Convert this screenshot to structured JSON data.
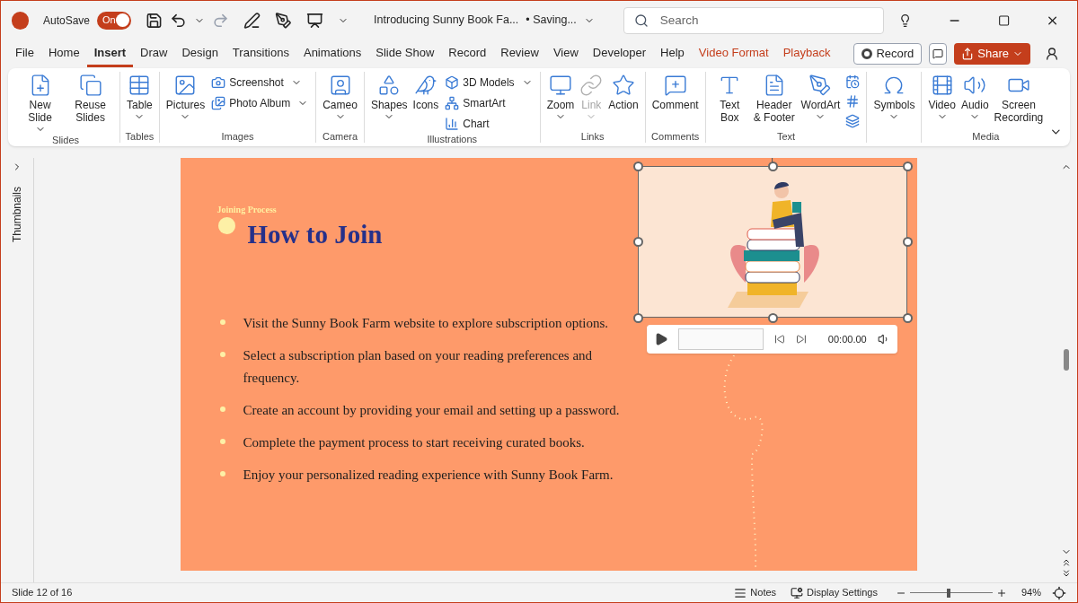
{
  "titlebar": {
    "autosave_label": "AutoSave",
    "autosave": {
      "label": "On",
      "on": true
    },
    "document_title": "Introducing Sunny Book Fa...",
    "save_status": "• Saving...",
    "search": {
      "placeholder": "Search"
    }
  },
  "menu_tabs": [
    {
      "label": "File",
      "selected": false,
      "kind": "normal"
    },
    {
      "label": "Home",
      "selected": false,
      "kind": "normal"
    },
    {
      "label": "Insert",
      "selected": true,
      "kind": "normal"
    },
    {
      "label": "Draw",
      "selected": false,
      "kind": "normal"
    },
    {
      "label": "Design",
      "selected": false,
      "kind": "normal"
    },
    {
      "label": "Transitions",
      "selected": false,
      "kind": "normal"
    },
    {
      "label": "Animations",
      "selected": false,
      "kind": "normal"
    },
    {
      "label": "Slide Show",
      "selected": false,
      "kind": "normal"
    },
    {
      "label": "Record",
      "selected": false,
      "kind": "normal"
    },
    {
      "label": "Review",
      "selected": false,
      "kind": "normal"
    },
    {
      "label": "View",
      "selected": false,
      "kind": "normal"
    },
    {
      "label": "Developer",
      "selected": false,
      "kind": "normal"
    },
    {
      "label": "Help",
      "selected": false,
      "kind": "normal"
    },
    {
      "label": "Video Format",
      "selected": false,
      "kind": "contextual"
    },
    {
      "label": "Playback",
      "selected": false,
      "kind": "contextual"
    }
  ],
  "record_button": "Record",
  "share_button": "Share",
  "ribbon_groups": [
    {
      "name": "Slides",
      "items": [
        {
          "label": "New Slide",
          "kind": "large",
          "dropdown": true
        },
        {
          "label": "Reuse Slides",
          "kind": "large"
        }
      ]
    },
    {
      "name": "Tables",
      "items": [
        {
          "label": "Table",
          "kind": "large",
          "dropdown": true
        }
      ]
    },
    {
      "name": "Images",
      "items": [
        {
          "label": "Pictures",
          "kind": "large",
          "dropdown": true
        },
        {
          "label": "Screenshot",
          "kind": "small",
          "dropdown": true
        },
        {
          "label": "Photo Album",
          "kind": "small",
          "dropdown": true
        }
      ]
    },
    {
      "name": "Camera",
      "items": [
        {
          "label": "Cameo",
          "kind": "large",
          "dropdown": true
        }
      ]
    },
    {
      "name": "Illustrations",
      "items": [
        {
          "label": "Shapes",
          "kind": "large",
          "dropdown": true
        },
        {
          "label": "Icons",
          "kind": "large"
        },
        {
          "label": "3D Models",
          "kind": "small",
          "dropdown": true
        },
        {
          "label": "SmartArt",
          "kind": "small"
        },
        {
          "label": "Chart",
          "kind": "small"
        }
      ]
    },
    {
      "name": "Links",
      "items": [
        {
          "label": "Zoom",
          "kind": "large",
          "dropdown": true
        },
        {
          "label": "Link",
          "kind": "large",
          "dropdown": true,
          "disabled": true
        },
        {
          "label": "Action",
          "kind": "large"
        }
      ]
    },
    {
      "name": "Comments",
      "items": [
        {
          "label": "Comment",
          "kind": "large"
        }
      ]
    },
    {
      "name": "Text",
      "items": [
        {
          "label": "Text Box",
          "kind": "large"
        },
        {
          "label": "Header & Footer",
          "kind": "large"
        },
        {
          "label": "WordArt",
          "kind": "large",
          "dropdown": true
        },
        {
          "kind": "icon"
        },
        {
          "kind": "icon"
        },
        {
          "kind": "icon"
        }
      ]
    },
    {
      "items": [
        {
          "label": "Symbols",
          "kind": "large",
          "dropdown": true
        }
      ]
    },
    {
      "name": "Media",
      "items": [
        {
          "label": "Video",
          "kind": "large",
          "dropdown": true
        },
        {
          "label": "Audio",
          "kind": "large",
          "dropdown": true
        },
        {
          "label": "Screen Recording",
          "kind": "large"
        }
      ]
    }
  ],
  "thumbnails_pane": {
    "label": "Thumbnails",
    "expanded": false
  },
  "slide": {
    "subtitle": "Joining Process",
    "title": "How to Join",
    "bullets": [
      "Visit the Sunny Book Farm website to explore subscription options.",
      "Select a subscription plan based on your reading preferences and frequency.",
      "Create an account by providing your email and setting up a password.",
      "Complete the payment process to start receiving curated books.",
      "Enjoy your personalized reading experience with Sunny Book Farm."
    ],
    "video": {
      "selected": true,
      "level": 0,
      "time": "00:00.00"
    }
  },
  "status_bar": {
    "slide_info": "Slide 12 of 16",
    "notes": "Notes",
    "display_settings": "Display Settings",
    "zoom": {
      "level": 0.47,
      "reading": "94%"
    }
  }
}
